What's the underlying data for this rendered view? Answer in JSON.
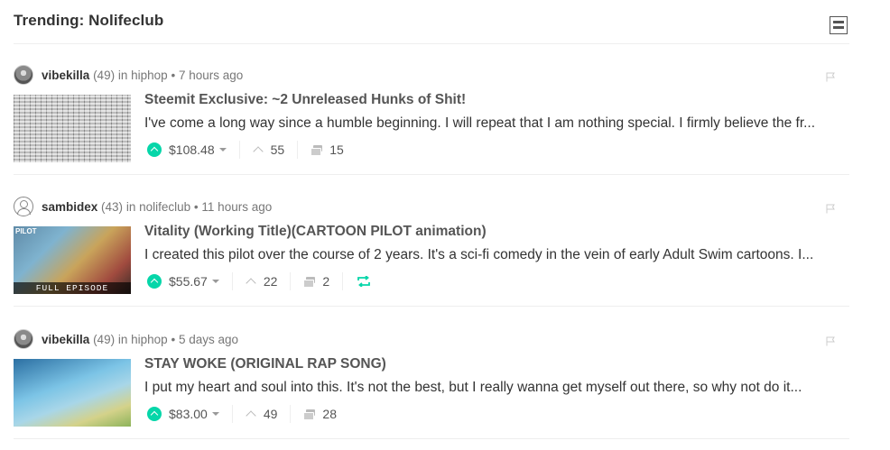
{
  "header": {
    "title": "Trending: Nolifeclub"
  },
  "colors": {
    "accent": "#06d6a9",
    "text": "#333333",
    "muted": "#777777"
  },
  "posts": [
    {
      "author": "vibekilla",
      "reputation": "(49)",
      "in": "in",
      "category": "hiphop",
      "dot": "•",
      "time": "7 hours ago",
      "avatar_icon": "avatar-icon",
      "title": "Steemit Exclusive: ~2 Unreleased Hunks of Shit!",
      "body": "I've come a long way since a humble beginning. I will repeat that I am nothing special. I firmly believe the fr...",
      "payout": "$108.48",
      "votes": "55",
      "comments": "15",
      "resteem": false
    },
    {
      "author": "sambidex",
      "reputation": "(43)",
      "in": "in",
      "category": "nolifeclub",
      "dot": "•",
      "time": "11 hours ago",
      "avatar_icon": "user-placeholder-icon",
      "title": "Vitality (Working Title)(CARTOON PILOT animation)",
      "body": "I created this pilot over the course of 2 years. It's a sci-fi comedy in the vein of early Adult Swim cartoons. I...",
      "payout": "$55.67",
      "votes": "22",
      "comments": "2",
      "resteem": true,
      "thumb_text": "FULL EPISODE",
      "thumb_tag": "PILOT"
    },
    {
      "author": "vibekilla",
      "reputation": "(49)",
      "in": "in",
      "category": "hiphop",
      "dot": "•",
      "time": "5 days ago",
      "avatar_icon": "avatar-icon",
      "title": "STAY WOKE (ORIGINAL RAP SONG)",
      "body": "I put my heart and soul into this. It's not the best, but I really wanna get myself out there, so why not do it...",
      "payout": "$83.00",
      "votes": "49",
      "comments": "28",
      "resteem": false
    }
  ]
}
